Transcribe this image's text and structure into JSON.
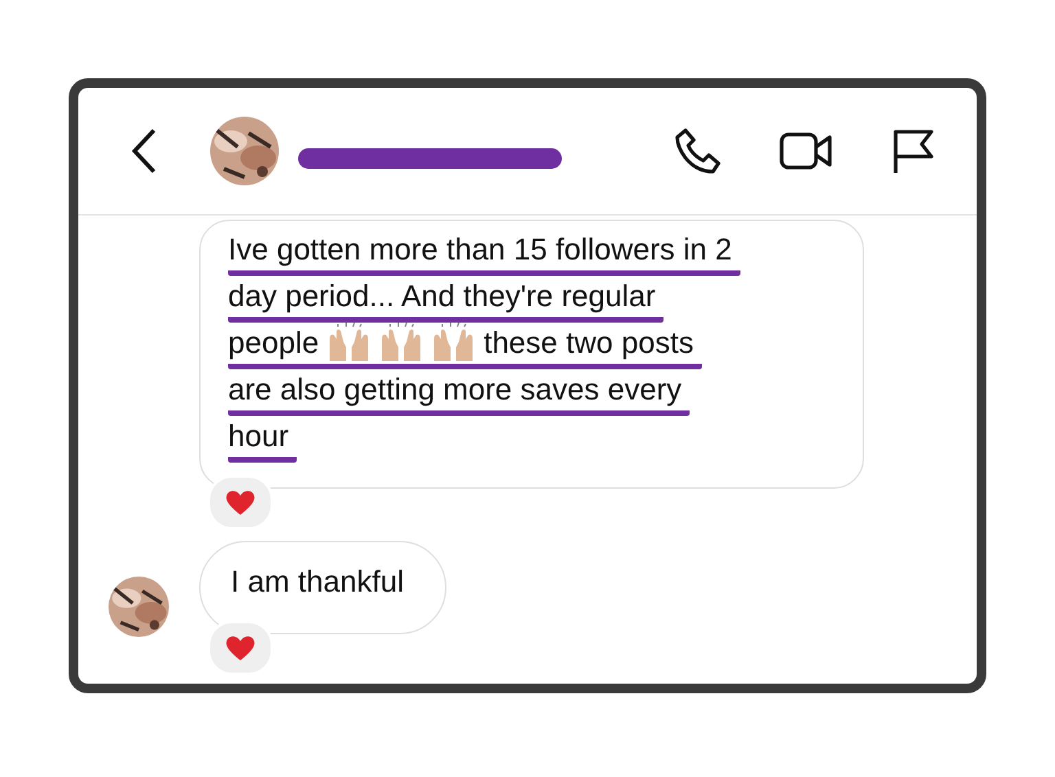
{
  "header": {
    "redacted_name": true
  },
  "messages": [
    {
      "avatar": false,
      "lines": [
        {
          "underlined": true,
          "segments": [
            {
              "kind": "text",
              "text": "Ive gotten more than 15 followers in 2"
            }
          ]
        },
        {
          "underlined": true,
          "segments": [
            {
              "kind": "text",
              "text": "day period... And they're regular"
            }
          ]
        },
        {
          "underlined": true,
          "segments": [
            {
              "kind": "text",
              "text": "people"
            },
            {
              "kind": "emoji"
            },
            {
              "kind": "emoji"
            },
            {
              "kind": "emoji"
            },
            {
              "kind": "text",
              "text": "these two posts"
            }
          ]
        },
        {
          "underlined": true,
          "segments": [
            {
              "kind": "text",
              "text": "are also getting more saves every"
            }
          ]
        },
        {
          "underlined": true,
          "segments": [
            {
              "kind": "text",
              "text": "hour"
            }
          ]
        }
      ],
      "reacted": true
    },
    {
      "avatar": true,
      "lines": [
        {
          "underlined": false,
          "segments": [
            {
              "kind": "text",
              "text": "I am thankful"
            }
          ]
        }
      ],
      "reacted": true
    }
  ]
}
